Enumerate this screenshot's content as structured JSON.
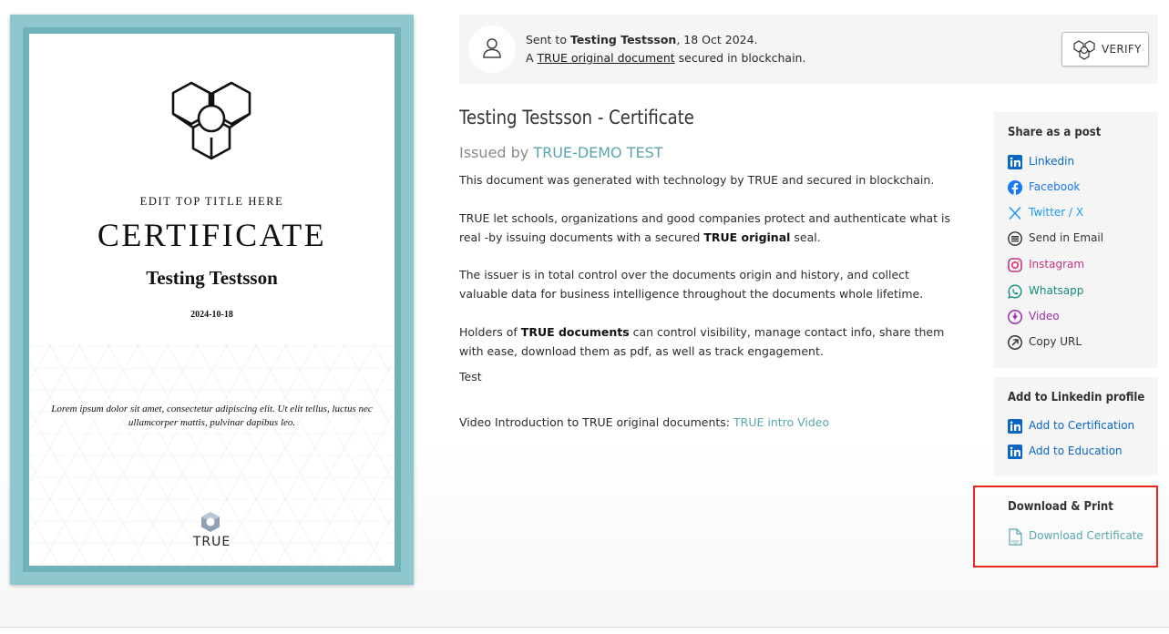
{
  "certificate": {
    "top_title": "EDIT TOP TITLE HERE",
    "title": "CERTIFICATE",
    "recipient": "Testing Testsson",
    "date": "2024-10-18",
    "lorem": "Lorem ipsum dolor sit amet, consectetur adipiscing elit. Ut elit tellus, luctus nec ullamcorper mattis, pulvinar dapibus leo.",
    "brand": "TRUE"
  },
  "sent": {
    "prefix": "Sent to ",
    "name": "Testing Testsson",
    "date_suffix": ", 18 Oct 2024.",
    "line2_prefix": "A ",
    "line2_link": "TRUE original document",
    "line2_suffix": " secured in blockchain.",
    "verify_label": "VERIFY"
  },
  "document": {
    "title": "Testing Testsson - Certificate",
    "issued_prefix": "Issued by ",
    "issuer": "TRUE-DEMO TEST",
    "p1": "This document was generated with technology by TRUE and secured in blockchain.",
    "p2_a": "TRUE let schools, organizations and good companies protect and authenticate what is real -by issuing documents with a secured ",
    "p2_b": "TRUE original",
    "p2_c": " seal.",
    "p3": "The issuer is in total control over the documents origin and history, and collect valuable data for business intelligence throughout the documents whole lifetime.",
    "p4_a": "Holders of ",
    "p4_b": "TRUE documents",
    "p4_c": " can control visibility, manage contact info, share them with ease, download them as pdf, as well as track engagement.",
    "p5": "Test",
    "video_prefix": "Video Introduction to TRUE original documents: ",
    "video_link": "TRUE intro Video"
  },
  "share": {
    "title": "Share as a post",
    "items": [
      {
        "label": "Linkedin",
        "color": "#0a66c2"
      },
      {
        "label": "Facebook",
        "color": "#1877f2"
      },
      {
        "label": "Twitter / X",
        "color": "#1d9bf0"
      },
      {
        "label": "Send in Email",
        "color": "#333333"
      },
      {
        "label": "Instagram",
        "color": "#c13584"
      },
      {
        "label": "Whatsapp",
        "color": "#128c7e"
      },
      {
        "label": "Video",
        "color": "#9b2fae"
      },
      {
        "label": "Copy URL",
        "color": "#333333"
      }
    ]
  },
  "linkedin_profile": {
    "title": "Add to Linkedin profile",
    "items": [
      {
        "label": "Add to Certification",
        "color": "#0a66c2"
      },
      {
        "label": "Add to Education",
        "color": "#0a66c2"
      }
    ]
  },
  "download": {
    "title": "Download & Print",
    "item": {
      "label": "Download Certificate",
      "color": "#5aa6b0"
    }
  },
  "colors": {
    "accent_teal": "#5aa6b0",
    "frame_outer": "#8ec7cd",
    "frame_inner": "#6fb2b9",
    "highlight": "#e8281b"
  }
}
